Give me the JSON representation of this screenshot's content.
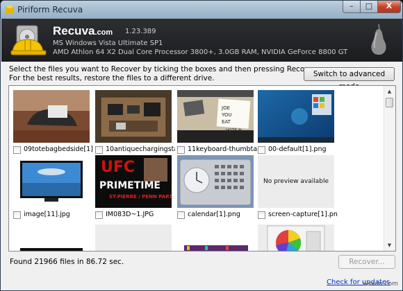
{
  "window": {
    "title": "Piriform Recuva",
    "minimize_label": "–",
    "maximize_label": "□",
    "close_label": "X"
  },
  "header": {
    "app_name": "Recuva",
    "app_domain": ".com",
    "version": "1.23.389",
    "os_line": "MS Windows Vista Ultimate SP1",
    "hw_line": "AMD Athlon 64 X2 Dual Core Processor 3800+, 3.0GB RAM, NVIDIA GeForce 8800 GT"
  },
  "instructions": {
    "line1": "Select the files you want to Recover by ticking the boxes and then pressing Recover.",
    "line2": "For the best results, restore the files to a different drive."
  },
  "advanced_button": "Switch to advanced mode",
  "no_preview_text": "No preview available",
  "files": [
    {
      "name": "09totebagbedside[1].j...",
      "checked": false
    },
    {
      "name": "10antiquechargingsta...",
      "checked": false
    },
    {
      "name": "11keyboard-thumbtac...",
      "checked": false
    },
    {
      "name": "00-default[1].png",
      "checked": false
    },
    {
      "name": "image[11].jpg",
      "checked": false
    },
    {
      "name": "IM083D~1.JPG",
      "checked": false
    },
    {
      "name": "calendar[1].png",
      "checked": false
    },
    {
      "name": "screen-capture[1].png",
      "checked": false
    }
  ],
  "thumb_text": {
    "ufc": "UFC",
    "primetime": "PRIMETIME",
    "fight": "ST-PIERRE / PENN  PART 2",
    "note_text": "JOE\nYOU\nEAT",
    "vote": "VOTE N"
  },
  "status": {
    "found": "Found 21966 files in 86.72 sec."
  },
  "recover_button": "Recover...",
  "check_updates": "Check for updates",
  "watermark": "wsxdn.com"
}
